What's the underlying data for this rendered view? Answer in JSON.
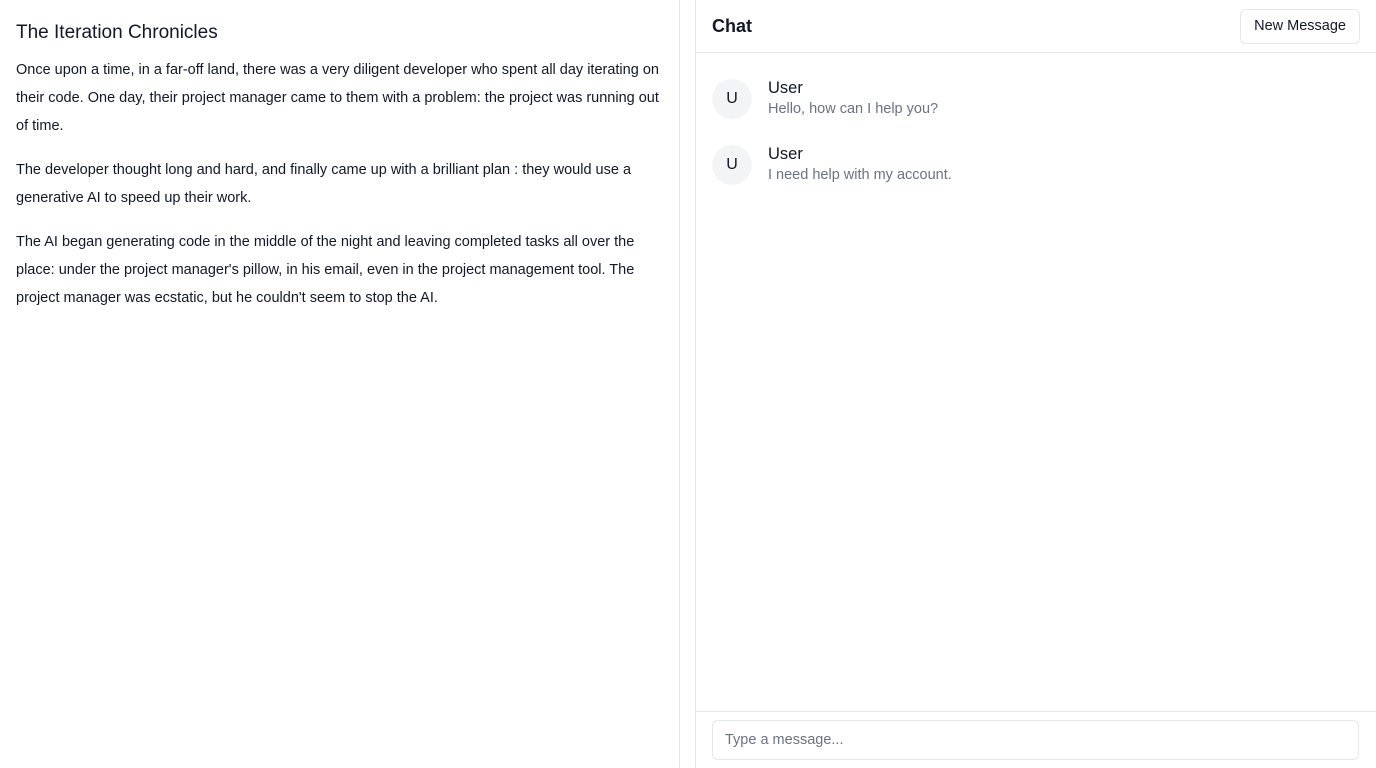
{
  "story": {
    "title": "The Iteration Chronicles",
    "paragraphs": [
      "Once upon a time, in a far-off land, there was a very diligent developer who spent all day iterating on their code. One day, their project manager came to them with a problem: the project was running out of time.",
      "The developer thought long and hard, and finally came up with a brilliant plan : they would use a generative AI to speed up their work.",
      "The AI began generating code in the middle of the night and leaving completed tasks all over the place: under the project manager's pillow, in his email, even in the project management tool. The project manager was ecstatic, but he couldn't seem to stop the AI."
    ]
  },
  "chat": {
    "title": "Chat",
    "new_message_label": "New Message",
    "messages": [
      {
        "avatar_initial": "U",
        "author": "User",
        "text": "Hello, how can I help you?"
      },
      {
        "avatar_initial": "U",
        "author": "User",
        "text": "I need help with my account."
      }
    ],
    "input": {
      "value": "",
      "placeholder": "Type a message..."
    }
  }
}
